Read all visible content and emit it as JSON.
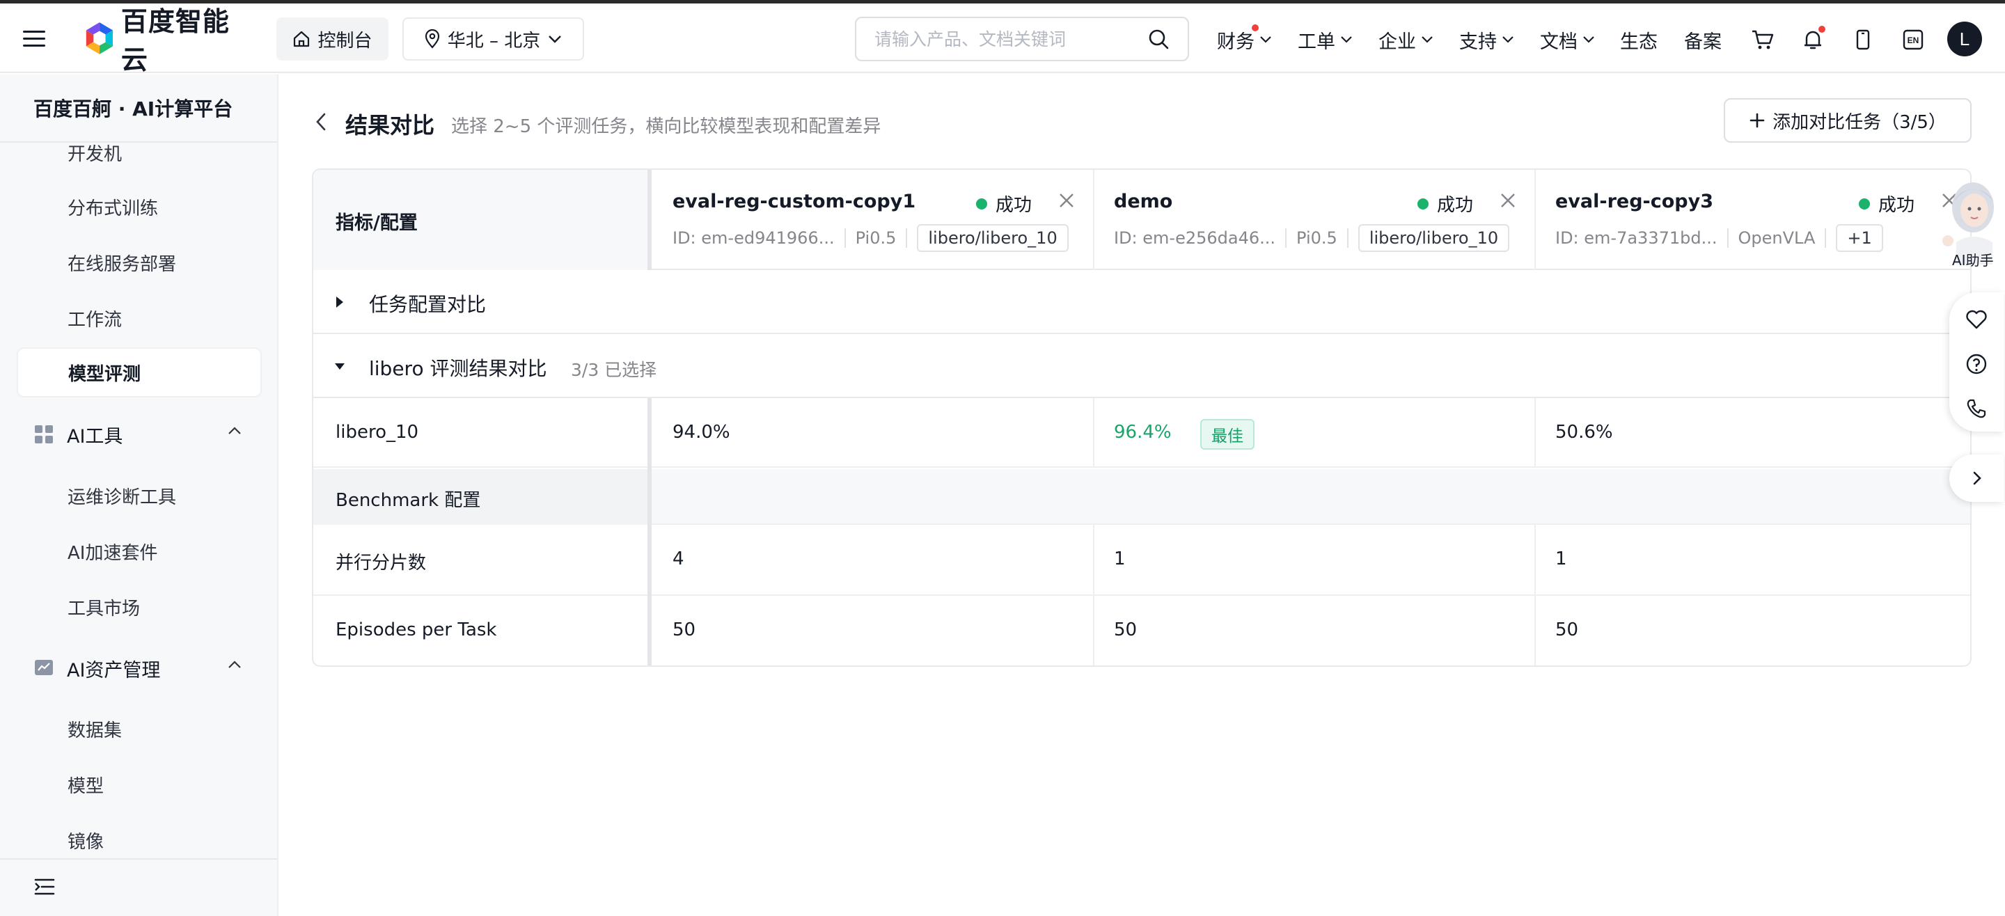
{
  "header": {
    "logo_text": "百度智能云",
    "console_label": "控制台",
    "region_label": "华北 – 北京",
    "search_placeholder": "请输入产品、文档关键词",
    "nav": {
      "finance": "财务",
      "ticket": "工单",
      "enterprise": "企业",
      "support": "支持",
      "docs": "文档",
      "ecosystem": "生态",
      "filing": "备案"
    },
    "lang": "EN",
    "avatar": "L"
  },
  "sidebar": {
    "title": "百度百舸 · AI计算平台",
    "items": [
      "开发机",
      "分布式训练",
      "在线服务部署",
      "工作流"
    ],
    "active": "模型评测",
    "groups": [
      {
        "label": "AI工具",
        "items": [
          "运维诊断工具",
          "AI加速套件",
          "工具市场"
        ]
      },
      {
        "label": "AI资产管理",
        "items": [
          "数据集",
          "模型",
          "镜像"
        ]
      }
    ]
  },
  "main": {
    "title": "结果对比",
    "subtitle": "选择 2~5 个评测任务，横向比较模型表现和配置差异",
    "add_button": "添加对比任务（3/5）",
    "header_label": "指标/配置",
    "tasks": [
      {
        "name": "eval-reg-custom-copy1",
        "status": "成功",
        "id": "ID: em-ed941966...",
        "model": "Pi0.5",
        "tag": "libero/libero_10"
      },
      {
        "name": "demo",
        "status": "成功",
        "id": "ID: em-e256da46...",
        "model": "Pi0.5",
        "tag": "libero/libero_10"
      },
      {
        "name": "eval-reg-copy3",
        "status": "成功",
        "id": "ID: em-7a3371bd...",
        "model": "OpenVLA",
        "tag": "+1"
      }
    ],
    "section_config": "任务配置对比",
    "section_results": "libero 评测结果对比",
    "section_results_count": "3/3 已选择",
    "metric_row": {
      "label": "libero_10",
      "values": [
        "94.0%",
        "96.4%",
        "50.6%"
      ],
      "best_label": "最佳"
    },
    "benchmark_group": "Benchmark 配置",
    "shards_row": {
      "label": "并行分片数",
      "values": [
        "4",
        "1",
        "1"
      ]
    },
    "episodes_row": {
      "label": "Episodes per Task",
      "values": [
        "50",
        "50",
        "50"
      ]
    }
  },
  "assistant": {
    "label": "AI助手"
  },
  "colors": {
    "success": "#19b36b",
    "best": "#19a56a",
    "danger": "#f0403c"
  }
}
